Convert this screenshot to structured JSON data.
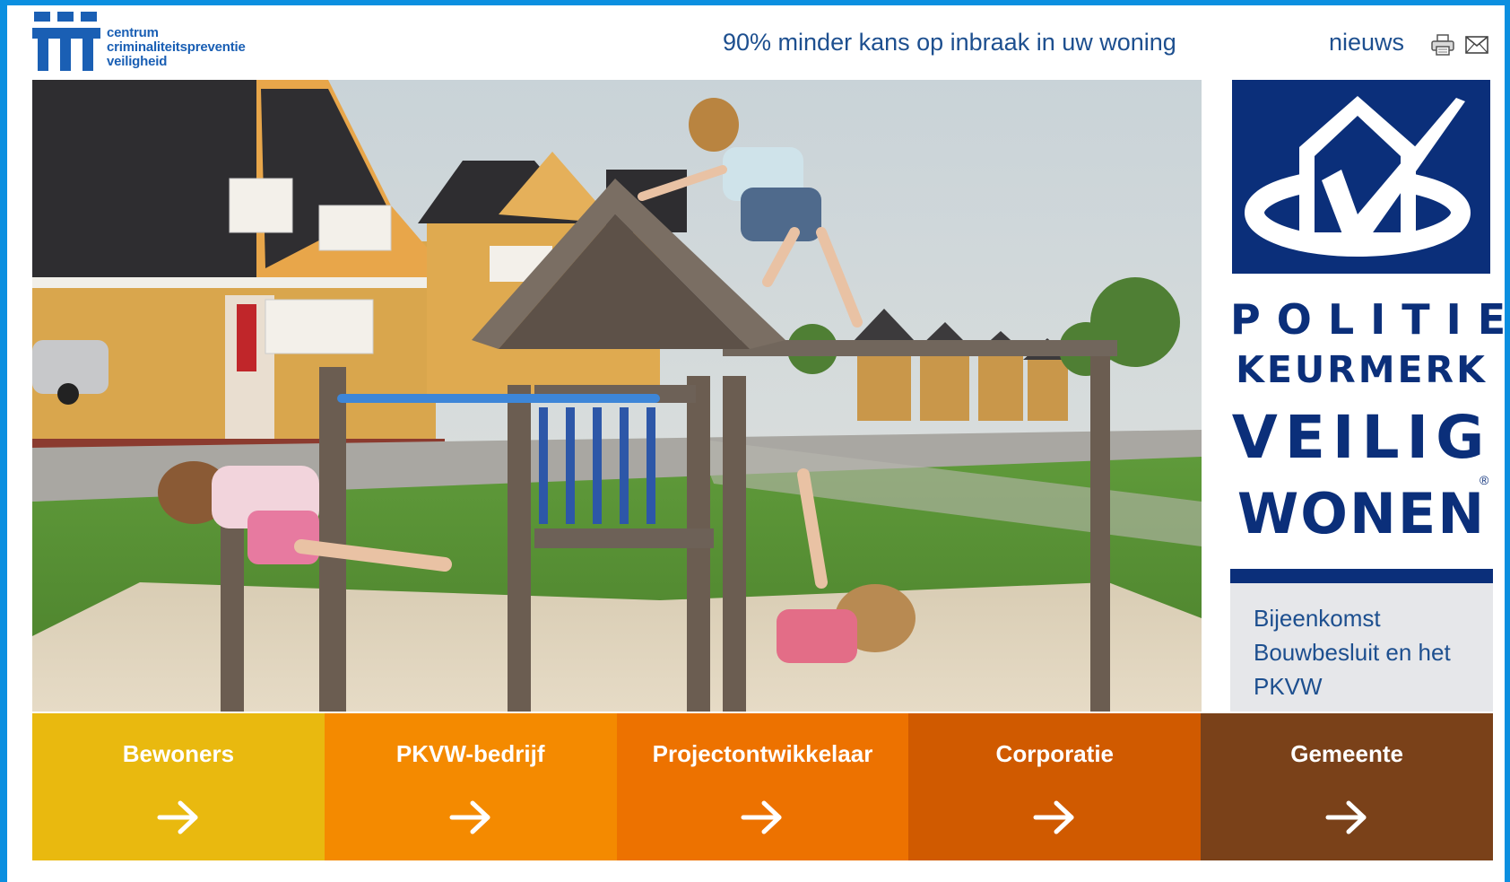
{
  "logo": {
    "lines": [
      "centrum",
      "criminaliteitspreventie",
      "veiligheid"
    ]
  },
  "header": {
    "tagline": "90% minder kans op inbraak in uw woning",
    "nav_link": "nieuws",
    "icons": [
      "print-icon",
      "mail-icon"
    ]
  },
  "keurmerk": {
    "line1": "POLITIE",
    "line2": "KEURMERK",
    "line3": "VEILIG",
    "line4": "WONEN",
    "registered": "®",
    "link": "Bijeenkomst Bouwbesluit en het PKVW"
  },
  "categories": [
    {
      "label": "Bewoners",
      "color": "#e9b90f"
    },
    {
      "label": "PKVW-bedrijf",
      "color": "#f48a00"
    },
    {
      "label": "Projectontwikkelaar",
      "color": "#ed7200"
    },
    {
      "label": "Corporatie",
      "color": "#d05a00"
    },
    {
      "label": "Gemeente",
      "color": "#7a4119"
    }
  ],
  "colors": {
    "frame": "#0b8fe0",
    "brand_blue": "#0b2f7a",
    "link_blue": "#1d4f8f"
  }
}
